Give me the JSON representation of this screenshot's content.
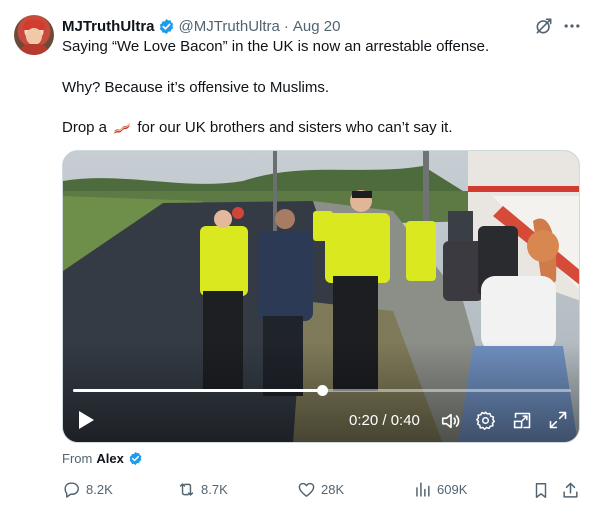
{
  "tweet": {
    "display_name": "MJTruthUltra",
    "handle": "@MJTruthUltra",
    "separator": "·",
    "date": "Aug 20",
    "line1": "Saying “We Love Bacon” in the UK is now an arrestable offense.",
    "line2": "Why? Because it’s offensive to Muslims.",
    "line3_before": "Drop a",
    "line3_emoji": "bacon-emoji",
    "line3_after": "for our UK brothers and sisters who can’t say it."
  },
  "video": {
    "time": "0:20 / 0:40",
    "progress": 0.5,
    "controls": [
      "play-icon",
      "volume-icon",
      "settings-icon",
      "picture-in-picture-icon",
      "fullscreen-icon"
    ]
  },
  "source": {
    "prefix": "From",
    "name": "Alex"
  },
  "actions": {
    "replies": "8.2K",
    "reposts": "8.7K",
    "likes": "28K",
    "views": "609K"
  },
  "colors": {
    "text": "#0f1419",
    "secondary": "#536471",
    "verified": "#1d9bf0",
    "background": "#ffffff"
  }
}
